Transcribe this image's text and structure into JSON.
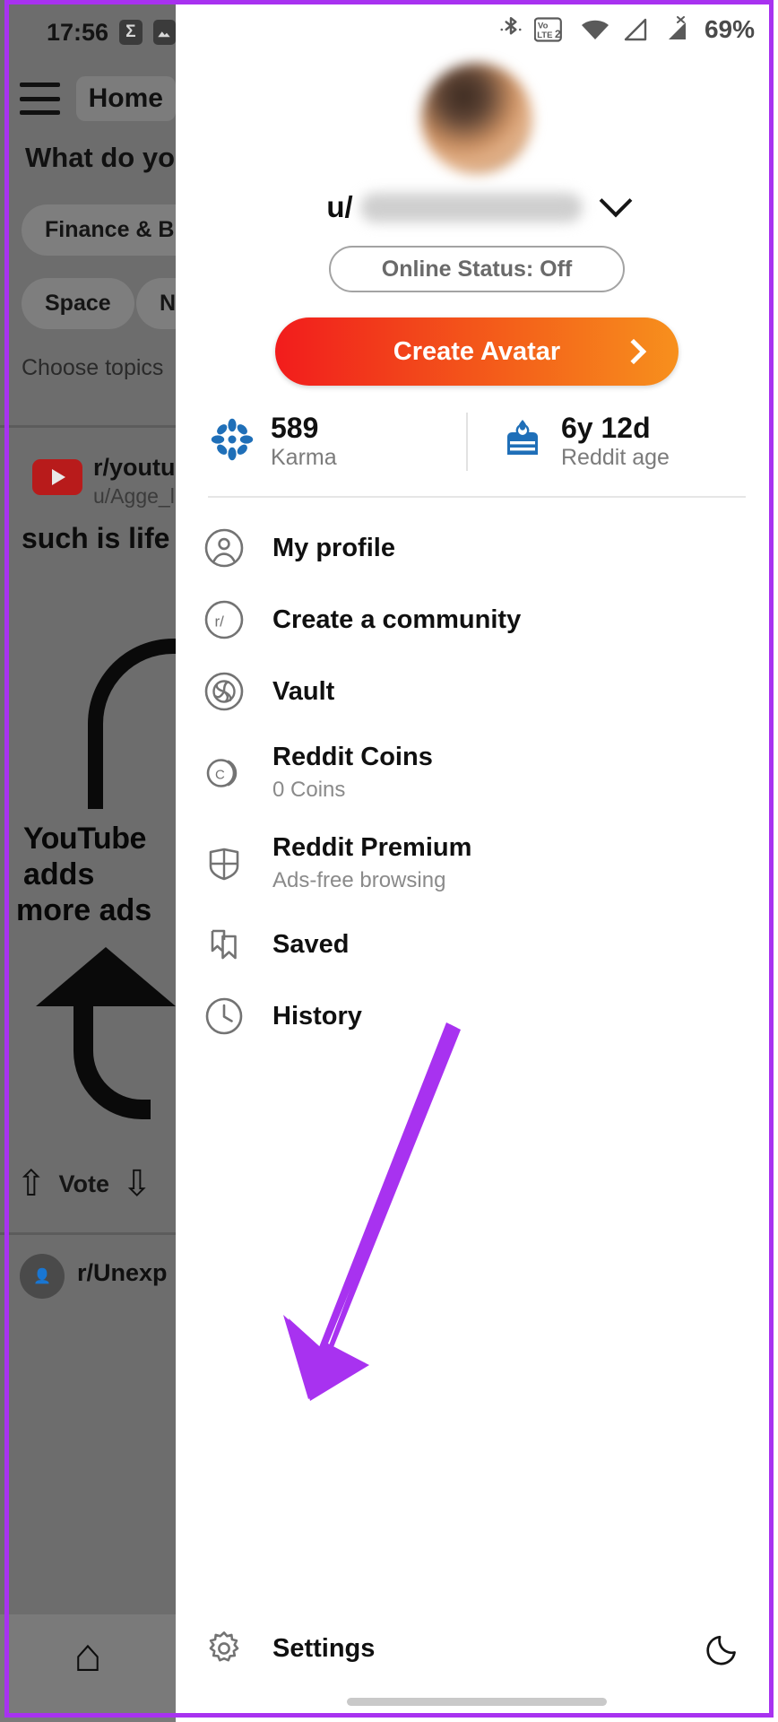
{
  "status_bar": {
    "time": "17:56",
    "battery": "69%",
    "icons": [
      "sigma-app-icon",
      "gallery-icon",
      "bluetooth-icon",
      "volte2-icon",
      "wifi-icon",
      "signal1-icon",
      "signal2-nosim-icon"
    ]
  },
  "background_feed": {
    "top_bar_title": "Home",
    "question": "What do yo",
    "chips": [
      "Finance & Bu",
      "Space",
      "N"
    ],
    "choose_topics": "Choose topics",
    "post": {
      "subreddit": "r/youtub",
      "author": "u/Agge_l",
      "title": "such is life",
      "meme_line_1": "YouTube",
      "meme_line_2": "adds",
      "meme_line_3": "more ads"
    },
    "vote_label": "Vote",
    "post2_subreddit": "r/Unexp",
    "nav_home": "home-icon"
  },
  "drawer": {
    "avatar": "user-avatar-blurred",
    "username_prefix": "u/",
    "username_redacted": "",
    "online_status": "Online Status: Off",
    "create_avatar": "Create Avatar",
    "stats": [
      {
        "icon": "karma-flower-icon",
        "value": "589",
        "label": "Karma"
      },
      {
        "icon": "cake-icon",
        "value": "6y 12d",
        "label": "Reddit age"
      }
    ],
    "menu": [
      {
        "icon": "profile-icon",
        "label": "My profile",
        "sub": ""
      },
      {
        "icon": "subreddit-icon",
        "label": "Create a community",
        "sub": ""
      },
      {
        "icon": "vault-icon",
        "label": "Vault",
        "sub": ""
      },
      {
        "icon": "coins-icon",
        "label": "Reddit Coins",
        "sub": "0 Coins"
      },
      {
        "icon": "shield-icon",
        "label": "Reddit Premium",
        "sub": "Ads-free browsing"
      },
      {
        "icon": "bookmark-icon",
        "label": "Saved",
        "sub": ""
      },
      {
        "icon": "clock-icon",
        "label": "History",
        "sub": ""
      }
    ],
    "settings": {
      "icon": "gear-icon",
      "label": "Settings"
    },
    "night_mode_icon": "moon-icon"
  },
  "annotation": {
    "border_color": "#a832f0",
    "arrow_color": "#a832f0",
    "arrow_points_to": "Settings"
  },
  "colors": {
    "accent_gradient_start": "#f21c1c",
    "accent_gradient_end": "#f7901d",
    "karma_blue": "#1f6fb8",
    "annotation_purple": "#a832f0"
  }
}
